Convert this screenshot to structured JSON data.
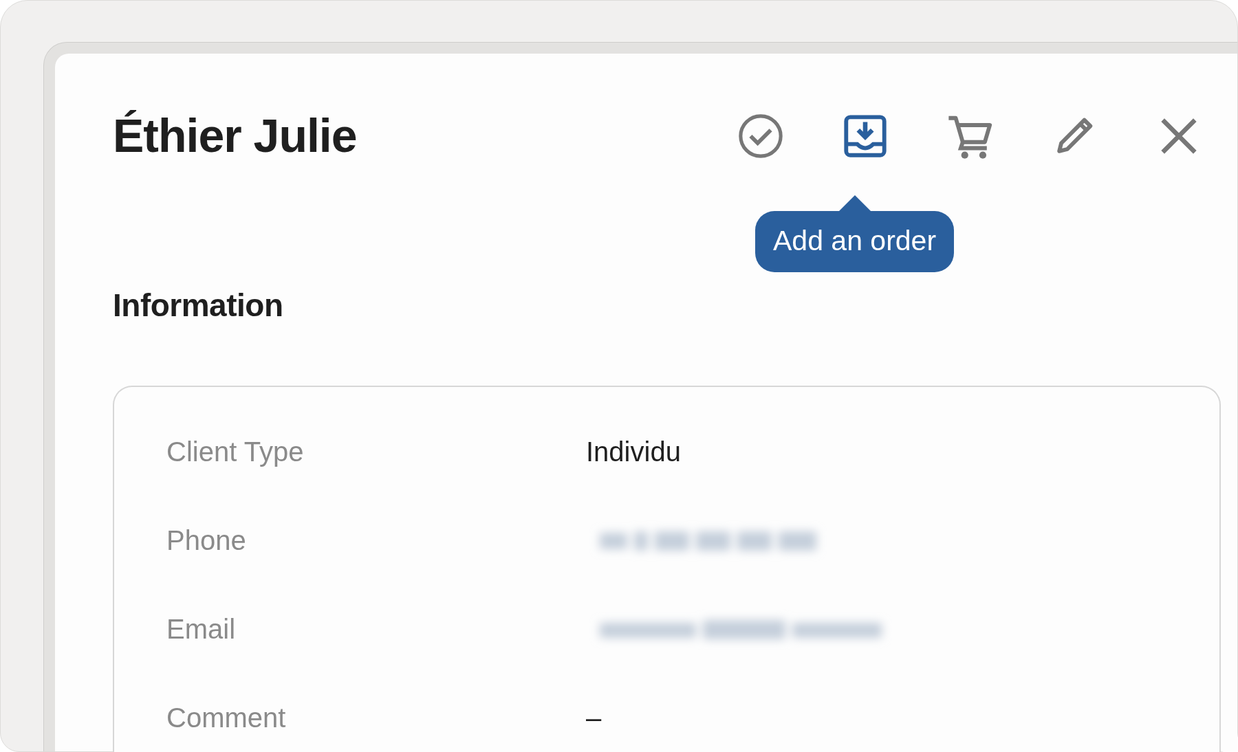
{
  "title": "Éthier Julie",
  "actions": [
    {
      "kind": "check",
      "highlighted": false
    },
    {
      "kind": "inbox",
      "highlighted": true
    },
    {
      "kind": "cart",
      "highlighted": false
    },
    {
      "kind": "pencil",
      "highlighted": false
    },
    {
      "kind": "close",
      "highlighted": false
    }
  ],
  "tooltip": "Add an order",
  "section_title": "Information",
  "fields": [
    {
      "label": "Client Type",
      "kind": "text",
      "value": "Individu"
    },
    {
      "label": "Phone",
      "kind": "redacted"
    },
    {
      "label": "Email",
      "kind": "redacted"
    },
    {
      "label": "Comment",
      "kind": "text",
      "value": "–"
    }
  ]
}
